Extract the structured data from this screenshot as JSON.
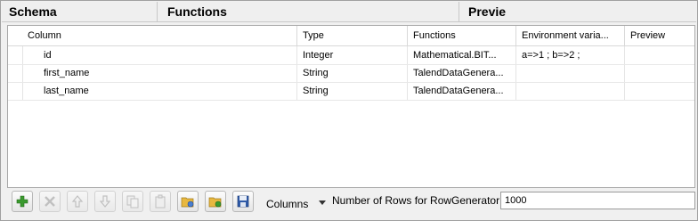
{
  "sections": {
    "schema": "Schema",
    "functions": "Functions",
    "preview": "Previe"
  },
  "table": {
    "headers": [
      "Column",
      "Type",
      "Functions",
      "Environment varia...",
      "Preview"
    ],
    "rows": [
      {
        "column": "id",
        "type": "Integer",
        "function": "Mathematical.BIT...",
        "env": "a=>1 ; b=>2 ;",
        "preview": ""
      },
      {
        "column": "first_name",
        "type": "String",
        "function": "TalendDataGenera...",
        "env": "",
        "preview": ""
      },
      {
        "column": "last_name",
        "type": "String",
        "function": "TalendDataGenera...",
        "env": "",
        "preview": ""
      }
    ]
  },
  "toolbar": {
    "buttons": [
      {
        "name": "add-row-button",
        "icon": "plus-icon",
        "enabled": true
      },
      {
        "name": "remove-row-button",
        "icon": "x-icon",
        "enabled": false
      },
      {
        "name": "move-up-button",
        "icon": "arrow-up-icon",
        "enabled": false
      },
      {
        "name": "move-down-button",
        "icon": "arrow-down-icon",
        "enabled": false
      },
      {
        "name": "copy-button",
        "icon": "copy-icon",
        "enabled": false
      },
      {
        "name": "paste-button",
        "icon": "paste-icon",
        "enabled": false
      },
      {
        "name": "import-button",
        "icon": "folder-import-icon",
        "enabled": true
      },
      {
        "name": "export-button",
        "icon": "folder-export-icon",
        "enabled": true
      },
      {
        "name": "save-button",
        "icon": "floppy-icon",
        "enabled": true
      }
    ],
    "columns_label": "Columns",
    "rows_label": "Number of Rows for RowGenerator",
    "rows_value": "1000"
  },
  "colors": {
    "add_green": "#3a9a2e",
    "disabled_gray": "#9a9a9a",
    "folder_yellow": "#e8b840",
    "floppy_blue": "#2f5aa8"
  }
}
